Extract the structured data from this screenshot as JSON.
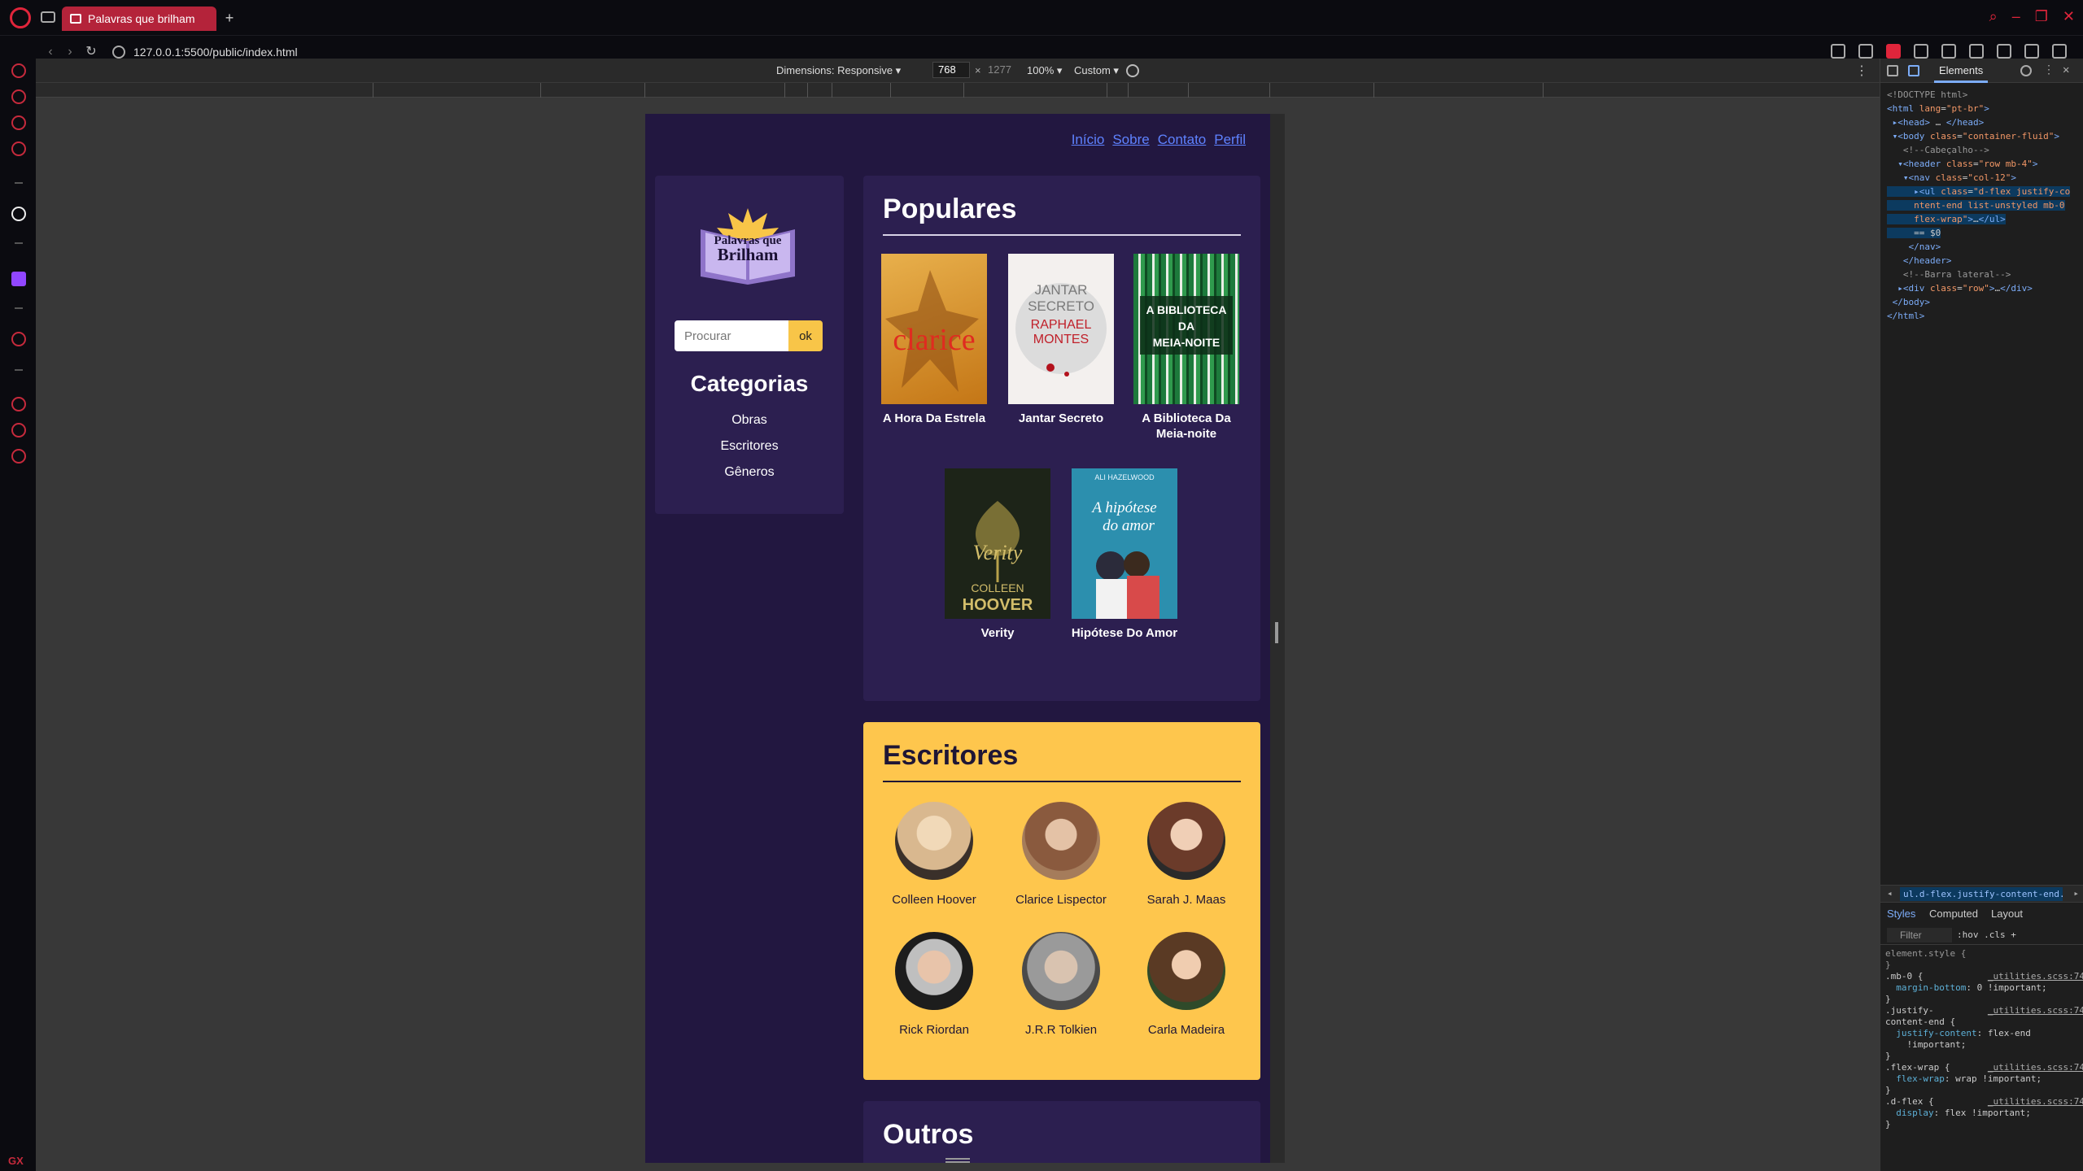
{
  "browser": {
    "tab_title": "Palavras que brilham",
    "url": "127.0.0.1:5500/public/index.html"
  },
  "device_toolbar": {
    "dimensions_label": "Dimensions: Responsive ▾",
    "width": "768",
    "height": "1277",
    "zoom": "100% ▾",
    "throttle": "Custom ▾"
  },
  "site": {
    "nav": [
      "Início",
      "Sobre",
      "Contato",
      "Perfil"
    ],
    "logo_text": [
      "Palavras que",
      "Brilham"
    ],
    "search": {
      "placeholder": "Procurar",
      "button": "ok"
    },
    "categories": {
      "title": "Categorias",
      "items": [
        "Obras",
        "Escritores",
        "Gêneros"
      ]
    },
    "populares": {
      "title": "Populares",
      "books": [
        {
          "title": "A Hora Da Estrela",
          "cover_text": "clarice",
          "cover_color": "#d8962a"
        },
        {
          "title": "Jantar Secreto",
          "cover_text": "JANTAR SECRETO RAPHAEL MONTES",
          "cover_color": "#f3f0ee"
        },
        {
          "title": "A Biblioteca Da Meia-noite",
          "cover_text": "A BIBLIOTECA DA MEIA-NOITE",
          "cover_color": "#1d7a3c"
        },
        {
          "title": "Verity",
          "cover_text": "COLLEEN HOOVER",
          "cover_color": "#1d2418"
        },
        {
          "title": "Hipótese Do Amor",
          "cover_text": "A hipótese do amor",
          "cover_color": "#2c8fae"
        }
      ]
    },
    "escritores": {
      "title": "Escritores",
      "writers": [
        {
          "name": "Colleen Hoover",
          "tone": "#d9b88f"
        },
        {
          "name": "Clarice Lispector",
          "tone": "#8a5a3e"
        },
        {
          "name": "Sarah J. Maas",
          "tone": "#6b3b2a"
        },
        {
          "name": "Rick Riordan",
          "tone": "#bfbfbf"
        },
        {
          "name": "J.R.R Tolkien",
          "tone": "#9a9a9a"
        },
        {
          "name": "Carla Madeira",
          "tone": "#5a3a24"
        }
      ]
    },
    "outros": {
      "title": "Outros"
    }
  },
  "devtools": {
    "panel_tab": "Elements",
    "breadcrumb": "ul.d-flex.justify-content-end.list-unsty",
    "styles_tabs": [
      "Styles",
      "Computed",
      "Layout"
    ],
    "filter_placeholder": "Filter",
    "filter_tools": ":hov .cls +"
  },
  "colors": {
    "page_bg": "#221740",
    "panel_bg": "#2c1f50",
    "accent_yellow": "#fec64d",
    "link_blue": "#5e82ff",
    "opera_red": "#e0253b"
  }
}
